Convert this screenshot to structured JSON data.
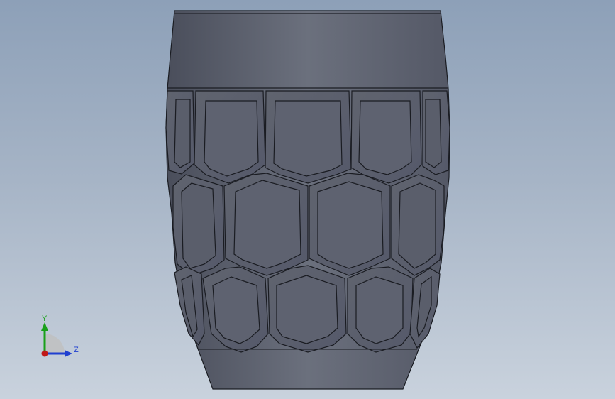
{
  "viewport": {
    "model": "hex-pattern-cup",
    "colors": {
      "bg_top": "#8da0b8",
      "bg_bottom": "#c9d2dd",
      "body_dark": "#4e5360",
      "body_mid": "#676c79",
      "body_light": "#747988",
      "facet_dark": "#3e424e",
      "edge": "#1a1c22"
    }
  },
  "triad": {
    "y_label": "Y",
    "z_label": "Z",
    "colors": {
      "y": "#19a019",
      "z": "#1f3fd0",
      "x": "#c01818",
      "plane": "#bfbfbf"
    }
  }
}
